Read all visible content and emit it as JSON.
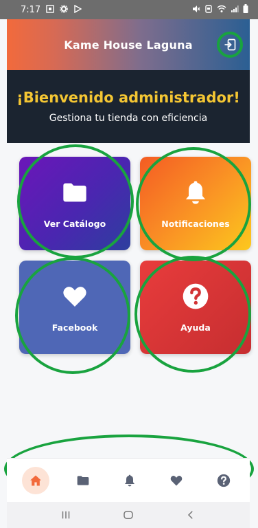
{
  "status_bar": {
    "time": "7:17",
    "left_icons": [
      "screenshot-icon",
      "gear-icon",
      "play-store-icon"
    ],
    "right_icons": [
      "mute-icon",
      "alarm-icon",
      "wifi-icon",
      "signal-icon",
      "battery-icon"
    ]
  },
  "header": {
    "title": "Kame House Laguna",
    "logout_icon": "logout-icon"
  },
  "welcome": {
    "title": "¡Bienvenido administrador!",
    "subtitle": "Gestiona tu tienda con eficiencia"
  },
  "tiles": [
    {
      "label": "Ver Catálogo",
      "icon": "folder-icon"
    },
    {
      "label": "Notificaciones",
      "icon": "bell-icon"
    },
    {
      "label": "Facebook",
      "icon": "heart-icon"
    },
    {
      "label": "Ayuda",
      "icon": "help-icon"
    }
  ],
  "bottom_nav": {
    "items": [
      {
        "icon": "home-icon",
        "active": true
      },
      {
        "icon": "folder-icon",
        "active": false
      },
      {
        "icon": "bell-icon",
        "active": false
      },
      {
        "icon": "heart-icon",
        "active": false
      },
      {
        "icon": "help-icon",
        "active": false
      }
    ]
  },
  "colors": {
    "accent": "#f26a3c",
    "annotation": "#19a33f",
    "welcome_title": "#f4c633",
    "banner_bg": "#1b2430",
    "nav_icon": "#5a6275"
  }
}
